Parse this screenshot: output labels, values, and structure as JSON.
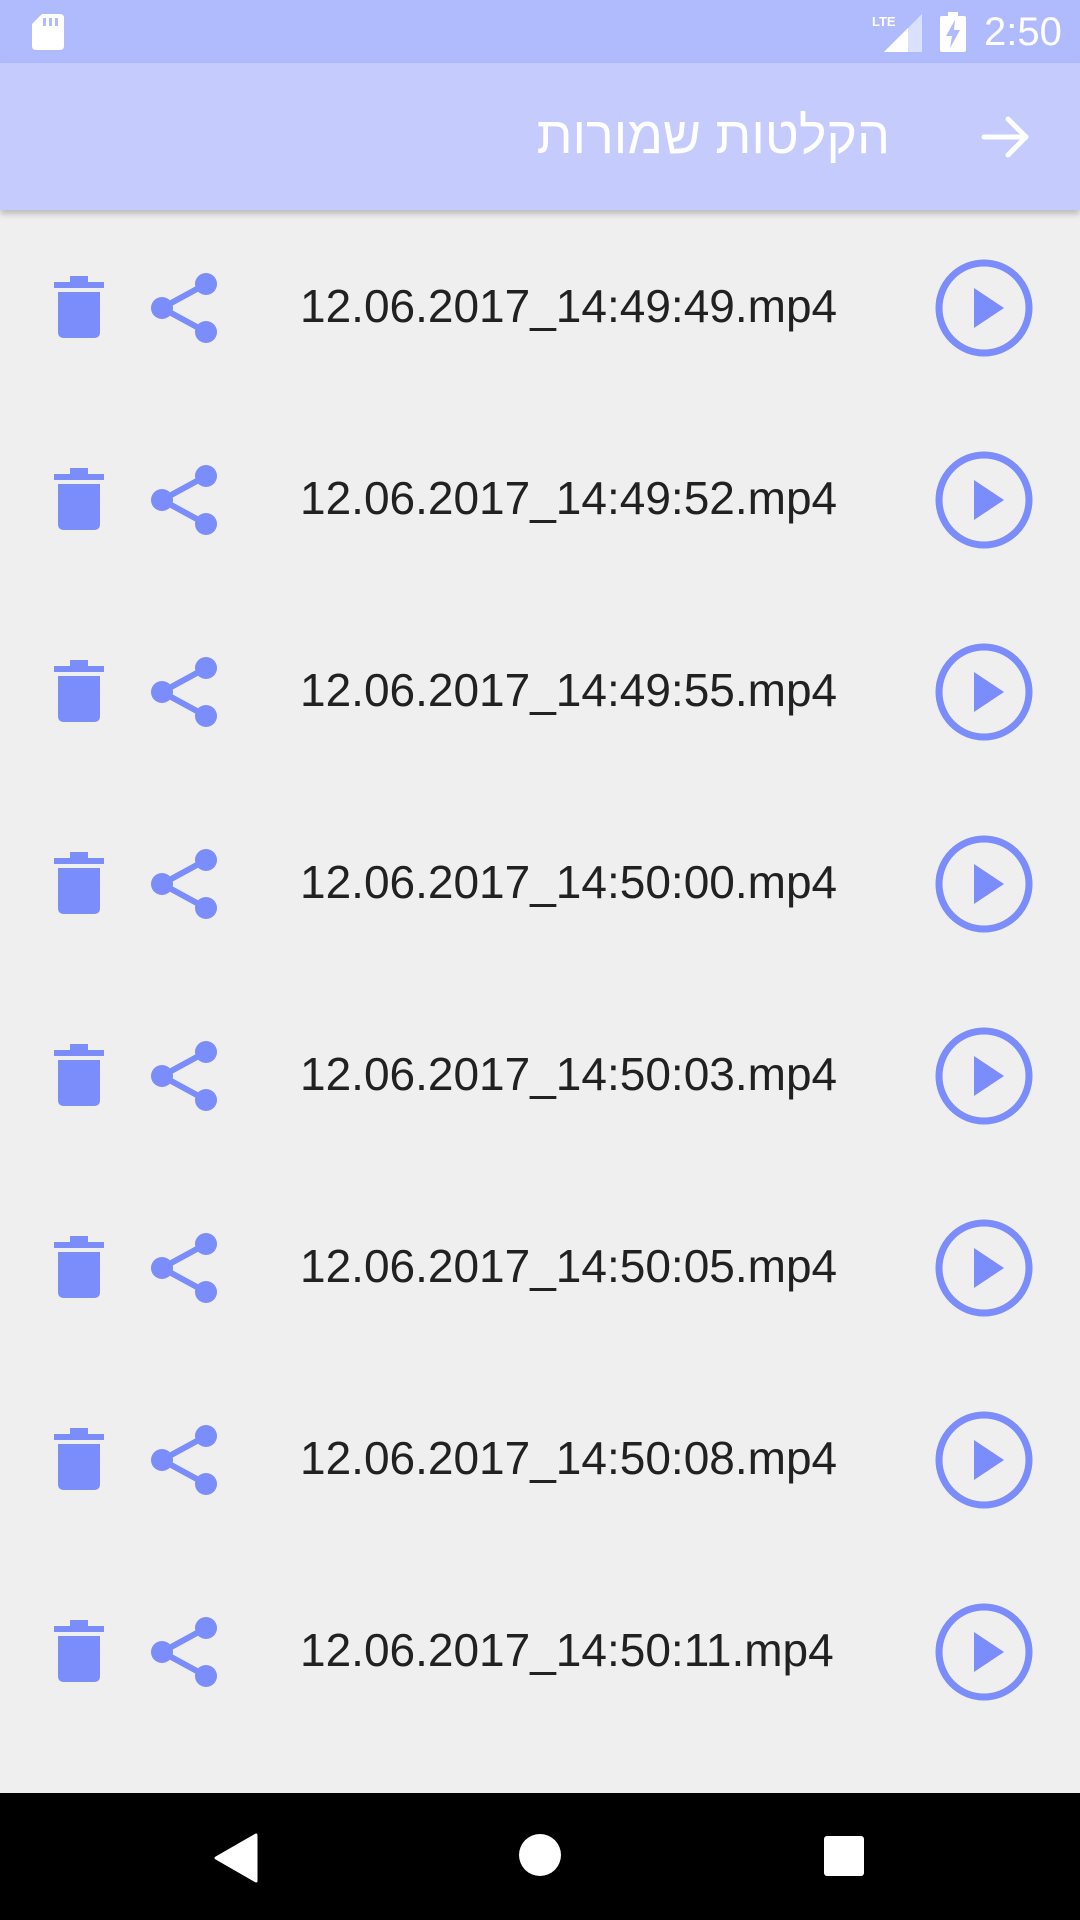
{
  "status_bar": {
    "time": "2:50",
    "network": "LTE",
    "icons": [
      "sd-card-icon",
      "lte-signal-icon",
      "battery-charging-icon"
    ]
  },
  "app_bar": {
    "title": "הקלטות שמורות",
    "back_icon": "arrow-right-icon"
  },
  "recordings": [
    {
      "filename": "12.06.2017_14:49:49.mp4"
    },
    {
      "filename": "12.06.2017_14:49:52.mp4"
    },
    {
      "filename": "12.06.2017_14:49:55.mp4"
    },
    {
      "filename": "12.06.2017_14:50:00.mp4"
    },
    {
      "filename": "12.06.2017_14:50:03.mp4"
    },
    {
      "filename": "12.06.2017_14:50:05.mp4"
    },
    {
      "filename": "12.06.2017_14:50:08.mp4"
    },
    {
      "filename": "12.06.2017_14:50:11.mp4"
    }
  ],
  "row_icons": {
    "delete": "trash-icon",
    "share": "share-icon",
    "play": "play-circle-icon"
  },
  "nav_bar": {
    "icons": [
      "nav-back-icon",
      "nav-home-icon",
      "nav-recents-icon"
    ]
  },
  "colors": {
    "status_bar": "#b0bbfd",
    "app_bar": "#c5cbfd",
    "background": "#f0eff0",
    "accent": "#7b8cfb",
    "text": "#212121"
  }
}
